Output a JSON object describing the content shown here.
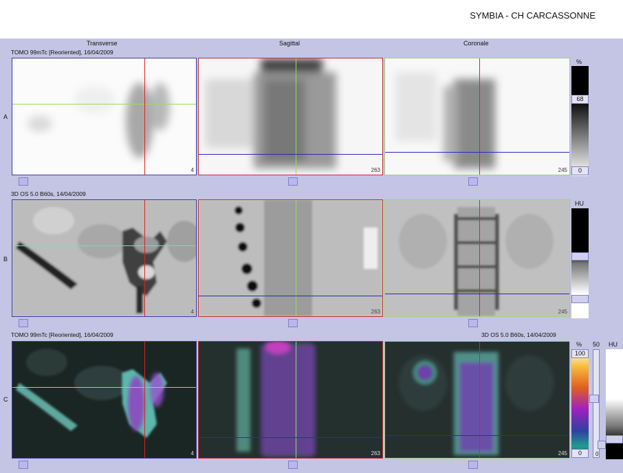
{
  "header": {
    "title": "SYMBIA - CH CARCASSONNE"
  },
  "columns": {
    "transverse": "Transverse",
    "sagittal": "Sagittal",
    "coronal": "Coronale"
  },
  "rows": {
    "a": {
      "letter": "A",
      "info": "TOMO 99mTc [Reoriented], 16/04/2009",
      "slices": {
        "transverse": "4",
        "sagittal": "263",
        "coronal": "245"
      },
      "scale": {
        "unit": "%",
        "window_value": "68",
        "min_value": "0"
      }
    },
    "b": {
      "letter": "B",
      "info": "3D  OS  5.0  B60s, 14/04/2009",
      "slices": {
        "transverse": "4",
        "sagittal": "263",
        "coronal": "245"
      },
      "scale": {
        "unit": "HU"
      }
    },
    "c": {
      "letter": "C",
      "info": "TOMO 99mTc [Reoriented], 16/04/2009",
      "info_right": "3D  OS  5.0  B60s, 14/04/2009",
      "slices": {
        "transverse": "4",
        "sagittal": "263",
        "coronal": "245"
      },
      "scale": {
        "unit_pct": "%",
        "top_pct": "100",
        "bottom_pct": "0",
        "mid_value": "50",
        "unit_hu": "HU",
        "bottom_hu": "0"
      }
    }
  },
  "colors": {
    "crosshair_red": "#e02020",
    "crosshair_green": "#90e060",
    "crosshair_blue": "#2828c0",
    "panel_bg": "#c4c4e4"
  }
}
